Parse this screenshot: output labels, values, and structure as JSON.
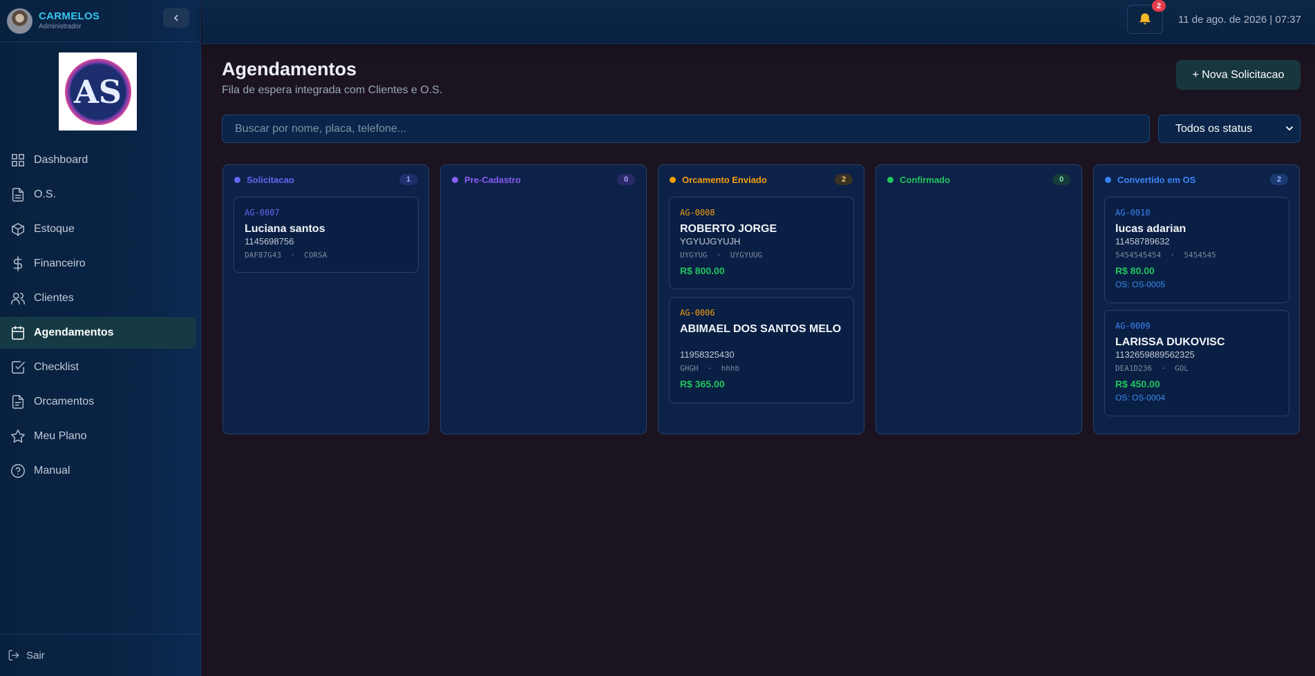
{
  "user": {
    "name": "CARMELOS",
    "role": "Administrador"
  },
  "logo": {
    "text": "AS"
  },
  "nav": [
    {
      "label": "Dashboard",
      "icon": "grid-icon"
    },
    {
      "label": "O.S.",
      "icon": "document-icon"
    },
    {
      "label": "Estoque",
      "icon": "box-icon"
    },
    {
      "label": "Financeiro",
      "icon": "dollar-icon"
    },
    {
      "label": "Clientes",
      "icon": "users-icon"
    },
    {
      "label": "Agendamentos",
      "icon": "calendar-icon",
      "active": true
    },
    {
      "label": "Checklist",
      "icon": "checklist-icon"
    },
    {
      "label": "Orcamentos",
      "icon": "file-text-icon"
    },
    {
      "label": "Meu Plano",
      "icon": "star-icon"
    },
    {
      "label": "Manual",
      "icon": "help-circle-icon"
    }
  ],
  "logout_label": "Sair",
  "topbar": {
    "notification_count": "2",
    "datetime": "11 de ago. de 2026 | 07:37"
  },
  "page": {
    "title": "Agendamentos",
    "subtitle": "Fila de espera integrada com Clientes e O.S.",
    "new_button": "+ Nova Solicitacao",
    "search_placeholder": "Buscar por nome, placa, telefone...",
    "status_filter": "Todos os status"
  },
  "columns": [
    {
      "title": "Solicitacao",
      "count": "1",
      "color": "#6366f1",
      "badge_bg": "#1e2f6b",
      "badge_fg": "#9aa6ff",
      "cards": [
        {
          "code": "AG-0007",
          "name": "Luciana santos",
          "phone": "1145698756",
          "plate": "DAF87G43",
          "model": "CORSA"
        }
      ]
    },
    {
      "title": "Pre-Cadastro",
      "count": "0",
      "color": "#8b5cf6",
      "badge_bg": "#272a66",
      "badge_fg": "#b4a2ff",
      "cards": []
    },
    {
      "title": "Orcamento Enviado",
      "count": "2",
      "color": "#f59e0b",
      "badge_bg": "#3a3226",
      "badge_fg": "#f2c46a",
      "cards": [
        {
          "code": "AG-0008",
          "name": "ROBERTO JORGE",
          "phone": "YGYUJGYUJH",
          "plate": "UYGYUG",
          "model": "UYGYUUG",
          "value": "R$ 800.00"
        },
        {
          "code": "AG-0006",
          "name": "ABIMAEL DOS SANTOS MELO",
          "phone": "11958325430",
          "plate": "GHGH",
          "model": "hhhb",
          "value": "R$ 365.00"
        }
      ]
    },
    {
      "title": "Confirmado",
      "count": "0",
      "color": "#22c55e",
      "badge_bg": "#163b3a",
      "badge_fg": "#7ee0a5",
      "cards": []
    },
    {
      "title": "Convertido em OS",
      "count": "2",
      "color": "#3b82f6",
      "badge_bg": "#1b3a72",
      "badge_fg": "#8fb8ff",
      "cards": [
        {
          "code": "AG-0010",
          "name": "lucas adarian",
          "phone": "11458789632",
          "plate": "5454545454",
          "model": "5454545",
          "value": "R$ 80.00",
          "os": "OS: OS-0005"
        },
        {
          "code": "AG-0009",
          "name": "LARISSA DUKOVISC",
          "phone": "1132659889562325",
          "plate": "DEA1D236",
          "model": "GOL",
          "value": "R$ 450.00",
          "os": "OS: OS-0004"
        }
      ]
    }
  ]
}
